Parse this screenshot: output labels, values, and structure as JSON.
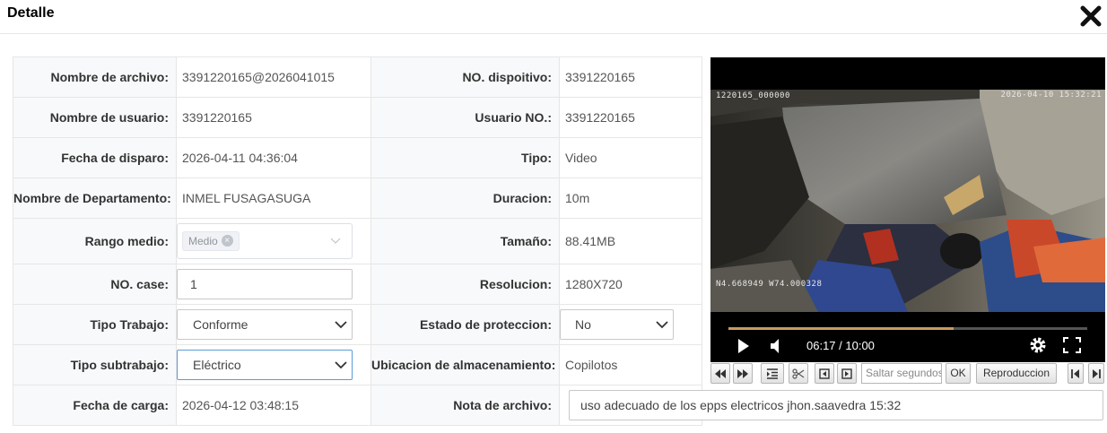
{
  "dialog": {
    "title": "Detalle",
    "close_icon": "close-x-icon"
  },
  "fields": {
    "nombre_archivo": {
      "label": "Nombre de archivo:",
      "value": "3391220165@2026041015"
    },
    "no_dispositivo": {
      "label": "NO. dispoitivo:",
      "value": "3391220165"
    },
    "nombre_usuario": {
      "label": "Nombre de usuario:",
      "value": "3391220165"
    },
    "usuario_no": {
      "label": "Usuario NO.:",
      "value": "3391220165"
    },
    "fecha_disparo": {
      "label": "Fecha de disparo:",
      "value": "2026-04-11 04:36:04"
    },
    "tipo": {
      "label": "Tipo:",
      "value": "Video"
    },
    "departamento": {
      "label": "Nombre de Departamento:",
      "value": "INMEL FUSAGASUGA"
    },
    "duracion": {
      "label": "Duracion:",
      "value": "10m"
    },
    "rango_medio": {
      "label": "Rango medio:",
      "tag": "Medio"
    },
    "tamano": {
      "label": "Tamaño:",
      "value": "88.41MB"
    },
    "no_case": {
      "label": "NO. case:",
      "value": "1"
    },
    "resolucion": {
      "label": "Resolucion:",
      "value": "1280X720"
    },
    "tipo_trabajo": {
      "label": "Tipo Trabajo:",
      "selected": "Conforme"
    },
    "estado_proteccion": {
      "label": "Estado de proteccion:",
      "selected": "No"
    },
    "tipo_subtrabajo": {
      "label": "Tipo subtrabajo:",
      "selected": "Eléctrico"
    },
    "ubicacion": {
      "label": "Ubicacion de almacenamiento:",
      "value": "Copilotos"
    },
    "fecha_carga": {
      "label": "Fecha de carga:",
      "value": "2026-04-12 03:48:15"
    },
    "nota": {
      "label": "Nota de archivo:",
      "value": "uso adecuado de los epps electricos jhon.saavedra 15:32"
    }
  },
  "player": {
    "osd_top_left": "1220165_000000",
    "osd_top_right": "2026-04-10 15:32:21",
    "osd_coords": "N4.668949  W74.000328",
    "time": "06:17 / 10:00",
    "progress": 0.628,
    "accent_color": "#c89b5c"
  },
  "toolbar": {
    "seek_placeholder": "Saltar segundos",
    "ok_label": "OK",
    "playback_label": "Reproduccion"
  }
}
